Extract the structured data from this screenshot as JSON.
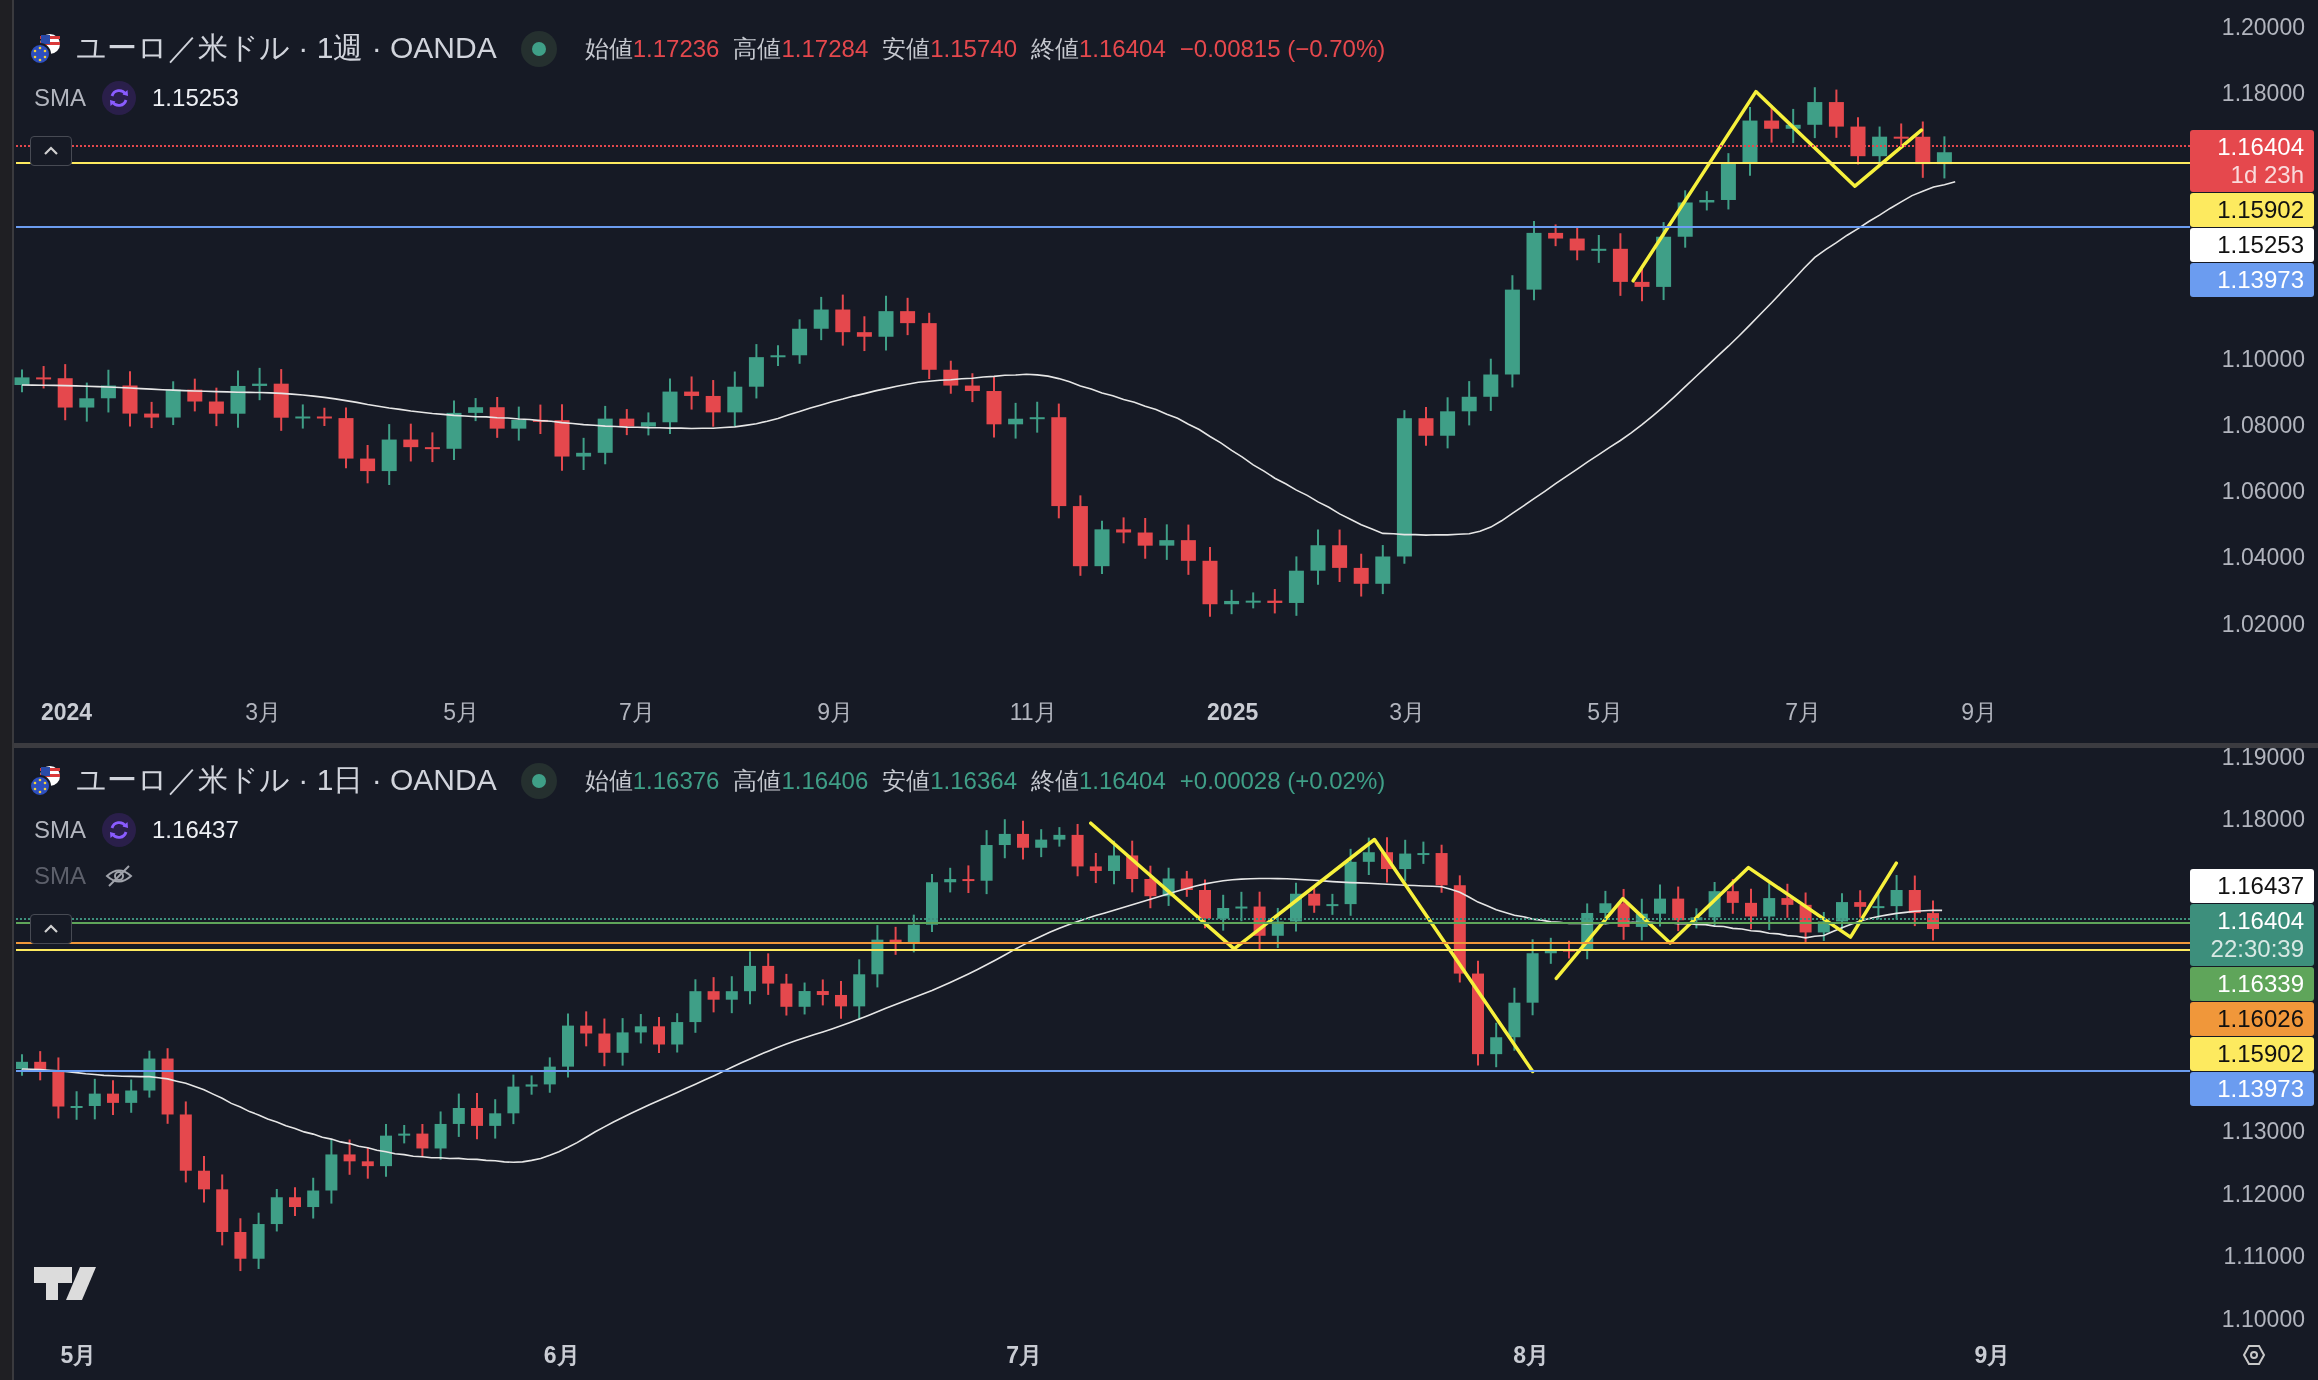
{
  "panes": [
    {
      "header": {
        "symbol": "ユーロ／米ドル · 1週 · OANDA",
        "ohlc": [
          {
            "label": "始値",
            "value": "1.17236"
          },
          {
            "label": "高値",
            "value": "1.17284"
          },
          {
            "label": "安値",
            "value": "1.15740"
          },
          {
            "label": "終値",
            "value": "1.16404"
          }
        ],
        "change": "−0.00815 (−0.70%)",
        "rising": false
      },
      "indicators": [
        {
          "name": "SMA",
          "value": "1.15253",
          "visible": true
        }
      ],
      "price_ticks": [
        "1.20000",
        "1.18000",
        "1.10000",
        "1.08000",
        "1.06000",
        "1.04000",
        "1.02000"
      ],
      "level_lines": [
        {
          "color": "#e5484d",
          "dotted": true
        },
        {
          "color": "#fdea5f",
          "dotted": false
        },
        {
          "color": "#6b9cf0",
          "dotted": false
        }
      ],
      "price_tags": [
        {
          "value": "1.16404",
          "sub": "1d 23h",
          "color": "#e5484d"
        },
        {
          "value": "1.15902",
          "color": "#fdea5f"
        },
        {
          "value": "1.15253",
          "color": "#ffffff"
        },
        {
          "value": "1.13973",
          "color": "#6b9cf0"
        }
      ],
      "time_labels": [
        {
          "text": "2024",
          "kind": "major"
        },
        {
          "text": "3月",
          "kind": "minor"
        },
        {
          "text": "5月",
          "kind": "minor"
        },
        {
          "text": "7月",
          "kind": "minor"
        },
        {
          "text": "9月",
          "kind": "minor"
        },
        {
          "text": "11月",
          "kind": "minor"
        },
        {
          "text": "2025",
          "kind": "major"
        },
        {
          "text": "3月",
          "kind": "minor"
        },
        {
          "text": "5月",
          "kind": "minor"
        },
        {
          "text": "7月",
          "kind": "minor"
        },
        {
          "text": "9月",
          "kind": "minor"
        }
      ]
    },
    {
      "header": {
        "symbol": "ユーロ／米ドル · 1日 · OANDA",
        "ohlc": [
          {
            "label": "始値",
            "value": "1.16376"
          },
          {
            "label": "高値",
            "value": "1.16406"
          },
          {
            "label": "安値",
            "value": "1.16364"
          },
          {
            "label": "終値",
            "value": "1.16404"
          }
        ],
        "change": "+0.00028 (+0.02%)",
        "rising": true
      },
      "indicators": [
        {
          "name": "SMA",
          "value": "1.16437",
          "visible": true
        },
        {
          "name": "SMA",
          "visible": false
        }
      ],
      "price_ticks": [
        "1.19000",
        "1.18000",
        "1.13000",
        "1.12000",
        "1.11000",
        "1.10000"
      ],
      "level_lines": [
        {
          "color": "#3d8f7c",
          "dotted": true
        },
        {
          "color": "#5fa55a",
          "dotted": false
        },
        {
          "color": "#f0973a",
          "dotted": false
        },
        {
          "color": "#fdea5f",
          "dotted": false
        },
        {
          "color": "#6b9cf0",
          "dotted": false
        }
      ],
      "price_tags": [
        {
          "value": "1.16437",
          "color": "#ffffff"
        },
        {
          "value": "1.16404",
          "sub": "22:30:39",
          "color": "#3d8f7c"
        },
        {
          "value": "1.16339",
          "color": "#5fa55a"
        },
        {
          "value": "1.16026",
          "color": "#f0973a"
        },
        {
          "value": "1.15902",
          "color": "#fdea5f"
        },
        {
          "value": "1.13973",
          "color": "#6b9cf0"
        }
      ],
      "time_labels": [
        {
          "text": "5月",
          "kind": "major"
        },
        {
          "text": "6月",
          "kind": "major"
        },
        {
          "text": "7月",
          "kind": "major"
        },
        {
          "text": "8月",
          "kind": "major"
        },
        {
          "text": "9月",
          "kind": "major"
        }
      ]
    }
  ]
}
